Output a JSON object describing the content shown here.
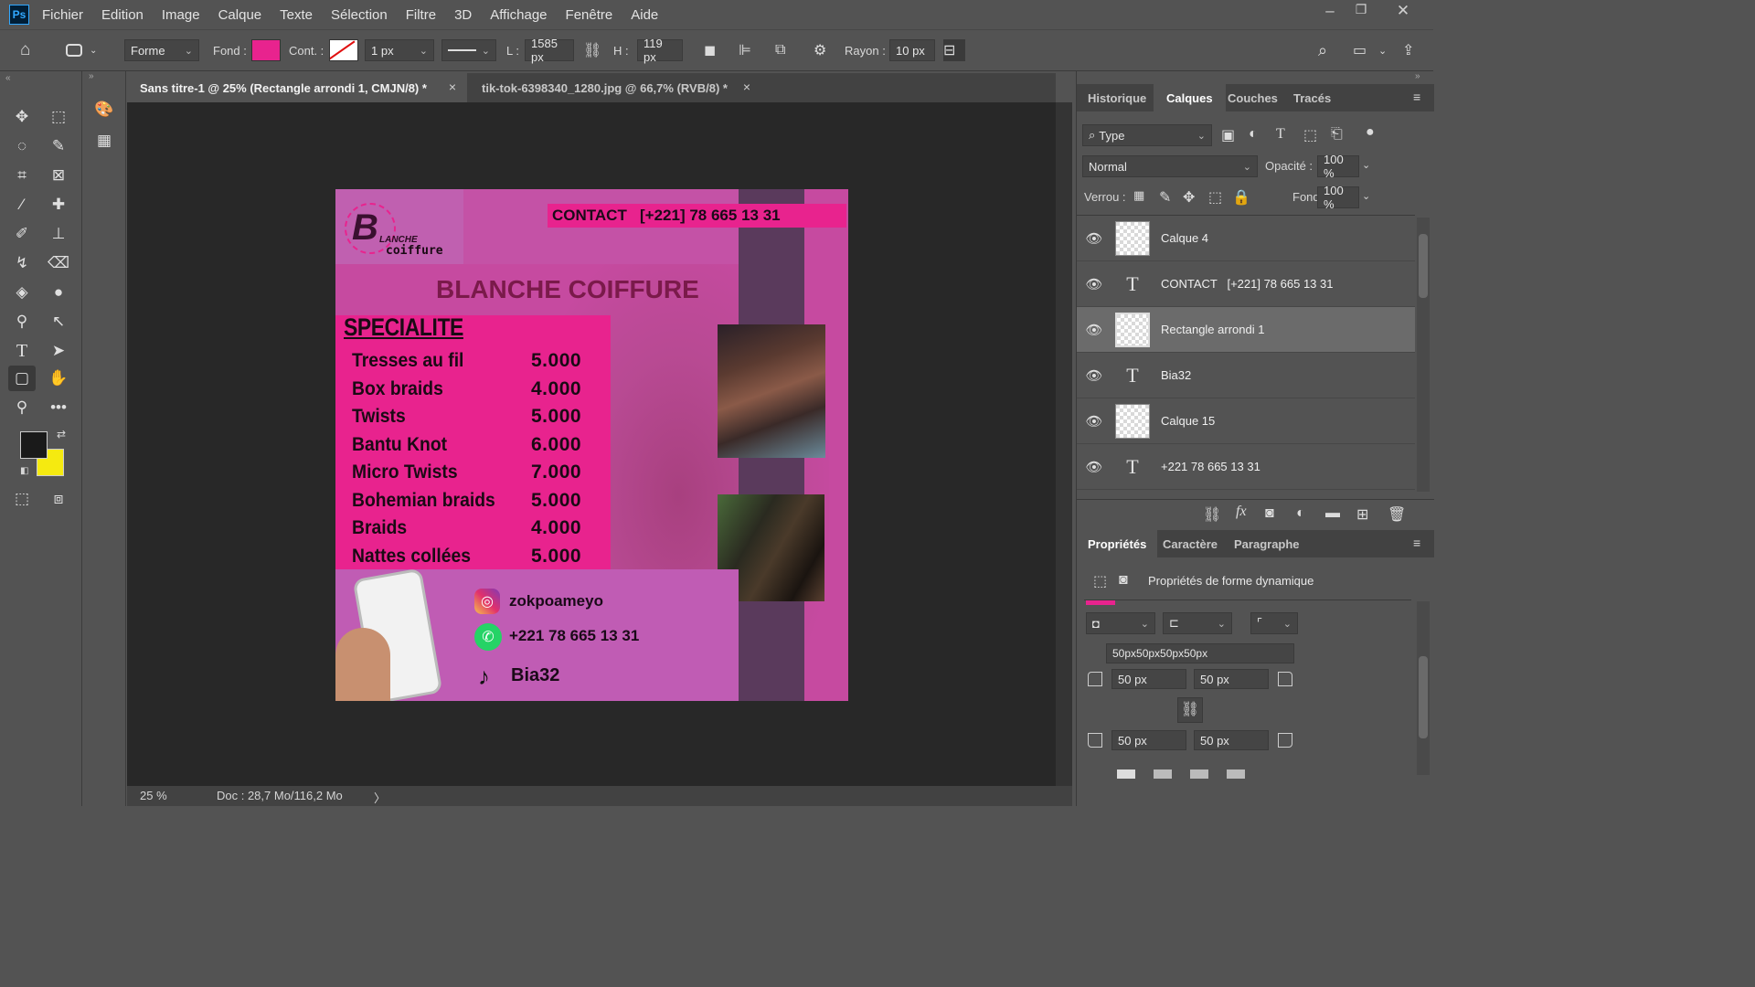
{
  "app": {
    "logo": "Ps"
  },
  "menu": [
    "Fichier",
    "Edition",
    "Image",
    "Calque",
    "Texte",
    "Sélection",
    "Filtre",
    "3D",
    "Affichage",
    "Fenêtre",
    "Aide"
  ],
  "options": {
    "mode": "Forme",
    "fill_label": "Fond :",
    "fill_color": "#e8238e",
    "stroke_label": "Cont. :",
    "stroke_width": "1 px",
    "w_label": "L :",
    "w_value": "1585 px",
    "h_label": "H :",
    "h_value": "119 px",
    "radius_label": "Rayon :",
    "radius_value": "10 px"
  },
  "tabs": [
    {
      "label": "Sans titre-1 @ 25% (Rectangle arrondi 1, CMJN/8) *",
      "close": "×"
    },
    {
      "label": "tik-tok-6398340_1280.jpg @ 66,7% (RVB/8) *",
      "close": "×"
    }
  ],
  "colors": {
    "foreground": "#1a1a1a",
    "background": "#f5ea10"
  },
  "document": {
    "logo_b": "B",
    "logo_lanche": "LANCHE",
    "logo_coiffure": "coiffure",
    "contact": "CONTACT   [+221] 78 665 13 31",
    "title": "BLANCHE COIFFURE",
    "heading": "SPECIALITE",
    "prices": [
      {
        "name": "Tresses au fil",
        "price": "5.000"
      },
      {
        "name": "Box braids",
        "price": "4.000"
      },
      {
        "name": "Twists",
        "price": "5.000"
      },
      {
        "name": "Bantu Knot",
        "price": "6.000"
      },
      {
        "name": "Micro Twists",
        "price": "7.000"
      },
      {
        "name": "Bohemian braids",
        "price": "5.000"
      },
      {
        "name": "Braids",
        "price": "4.000"
      },
      {
        "name": "Nattes collées",
        "price": "5.000"
      }
    ],
    "instagram": "zokpoameyo",
    "whatsapp": "+221 78 665 13 31",
    "tiktok": "Bia32"
  },
  "status": {
    "zoom": "25 %",
    "doc": "Doc : 28,7 Mo/116,2 Mo",
    "arrow": "〉"
  },
  "panel_tabs": [
    "Historique",
    "Calques",
    "Couches",
    "Tracés"
  ],
  "layers_panel": {
    "filter": "Type",
    "blend": "Normal",
    "opacity_label": "Opacité :",
    "opacity": "100 %",
    "lock_label": "Verrou :",
    "fill_label": "Fond :",
    "fill": "100 %"
  },
  "layers": [
    {
      "name": "Calque 4",
      "kind": "pixel"
    },
    {
      "name": "CONTACT   [+221] 78 665 13 31",
      "kind": "text"
    },
    {
      "name": "Rectangle arrondi 1",
      "kind": "shape"
    },
    {
      "name": "Bia32",
      "kind": "text"
    },
    {
      "name": "Calque 15",
      "kind": "pixel"
    },
    {
      "name": "+221 78 665 13 31",
      "kind": "text"
    }
  ],
  "props_tabs": [
    "Propriétés",
    "Caractère",
    "Paragraphe"
  ],
  "props": {
    "title": "Propriétés de forme dynamique",
    "corners": "50px50px50px50px",
    "c1": "50 px",
    "c2": "50 px",
    "c3": "50 px",
    "c4": "50 px"
  }
}
